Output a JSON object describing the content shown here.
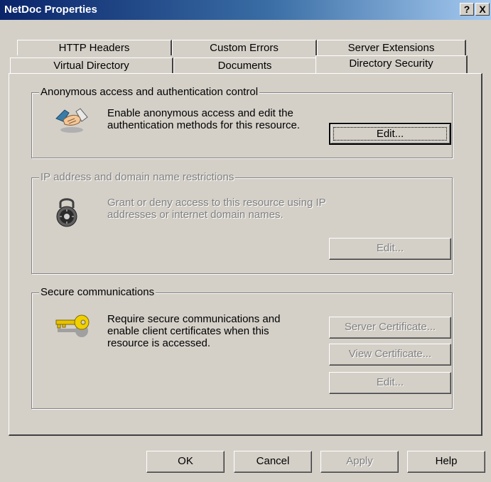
{
  "window": {
    "title": "NetDoc Properties",
    "help_glyph": "?",
    "close_glyph": "X"
  },
  "tabs": {
    "row1": [
      "HTTP Headers",
      "Custom Errors",
      "Server Extensions"
    ],
    "row2": [
      "Virtual Directory",
      "Documents",
      "Directory Security"
    ],
    "active": "Directory Security"
  },
  "groups": {
    "anonymous": {
      "title": "Anonymous access and authentication control",
      "text": "Enable anonymous access and edit the authentication methods for this resource.",
      "edit_label": "Edit...",
      "icon": "handshake-icon"
    },
    "ip": {
      "title": "IP address and domain name restrictions",
      "text": "Grant or deny access to this resource using IP addresses or internet domain names.",
      "edit_label": "Edit...",
      "icon": "padlock-icon"
    },
    "secure": {
      "title": "Secure communications",
      "text": "Require secure communications and enable client certificates when this resource is accessed.",
      "server_cert_label": "Server Certificate...",
      "view_cert_label": "View Certificate...",
      "edit_label": "Edit...",
      "icon": "keys-icon"
    }
  },
  "footer": {
    "ok_label": "OK",
    "cancel_label": "Cancel",
    "apply_label": "Apply",
    "help_label": "Help"
  }
}
